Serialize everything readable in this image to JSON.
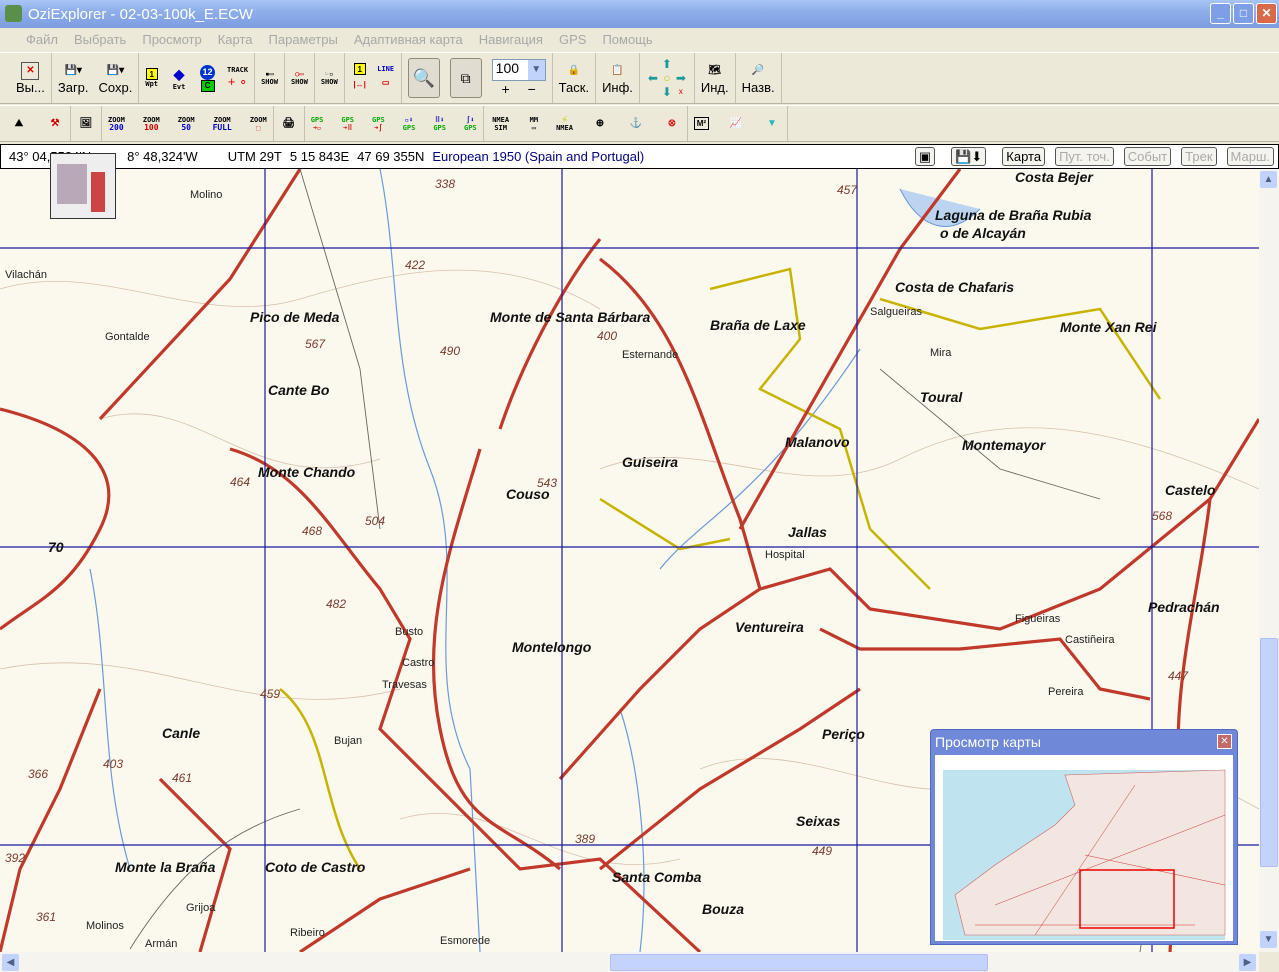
{
  "window": {
    "title": "OziExplorer - 02-03-100k_E.ECW",
    "minimize": "_",
    "maximize": "□",
    "close": "✕"
  },
  "menu": [
    "Файл",
    "Выбрать",
    "Просмотр",
    "Карта",
    "Параметры",
    "Адаптивная карта",
    "Навигация",
    "GPS",
    "Помощь"
  ],
  "toolbar1": {
    "exit": "Вы...",
    "load": "Загр.",
    "save": "Сохр.",
    "wpt": "Wpt",
    "evt": "Evt",
    "badge12": "12",
    "track": "TRACK",
    "c": "C",
    "show": "SHOW",
    "line": "LINE",
    "zoom_value": "100",
    "zoom_in": "+",
    "zoom_out": "−",
    "drag": "Таск.",
    "info": "Инф.",
    "index": "Инд.",
    "names": "Назв."
  },
  "toolbar2": {
    "zooms": [
      "200",
      "100",
      "50",
      "FULL"
    ],
    "zoom_word": "ZOOM",
    "gps": "GPS",
    "nmea_sim": "NMEA SIM",
    "mm": "MM",
    "nmea": "NMEA",
    "m2": "M²"
  },
  "status": {
    "lat": "43° 04,5524'N",
    "lon": "8° 48,324'W",
    "utm": "UTM  29T",
    "easting": "5 15 843E",
    "northing": "47 69 355N",
    "datum": "European 1950 (Spain and Portugal)",
    "buttons": [
      "Карта",
      "Пут. точ.",
      "Событ",
      "Трек",
      "Марш."
    ]
  },
  "overview": {
    "title": "Просмотр карты",
    "close": "✕"
  },
  "map": {
    "labels": [
      "Costa Bejer",
      "Laguna de Braña Rubia",
      "o de Alcayán",
      "Pico de Meda",
      "567",
      "Braña de Laxe",
      "Costa de Chafaris",
      "Monte Xan Rei",
      "Cante Bo",
      "Monte de Santa Bárbara",
      "Malanovo",
      "Toural",
      "Montemayor",
      "Monte Chando",
      "Guiseira",
      "Couso",
      "543",
      "Castelo",
      "568",
      "70",
      "Montelongo",
      "Ventureira",
      "Pedrachán",
      "Canle",
      "461",
      "Periço",
      "Seixas",
      "449",
      "Monte la Braña",
      "Coto de Castro",
      "Santa Comba",
      "Bouza",
      "389",
      "Vilachán",
      "Molino",
      "Gontalde",
      "Salgueiras",
      "Mira",
      "Esternande",
      "Hospital",
      "Jallas",
      "Busto",
      "Castro",
      "Travesas",
      "Bujan",
      "Figueiras",
      "Castiñeira",
      "Pereira",
      "Ribeiro",
      "Grijoa",
      "Armán",
      "Esmorede",
      "Molinos",
      "457",
      "422",
      "490",
      "464",
      "482",
      "459",
      "447",
      "403",
      "366",
      "392",
      "361",
      "468",
      "504",
      "338",
      "400"
    ]
  },
  "colors": {
    "road": "#c0392b",
    "grid": "#1a1aa0",
    "map_bg": "#fbf8ee",
    "water": "#6a9ad8"
  }
}
